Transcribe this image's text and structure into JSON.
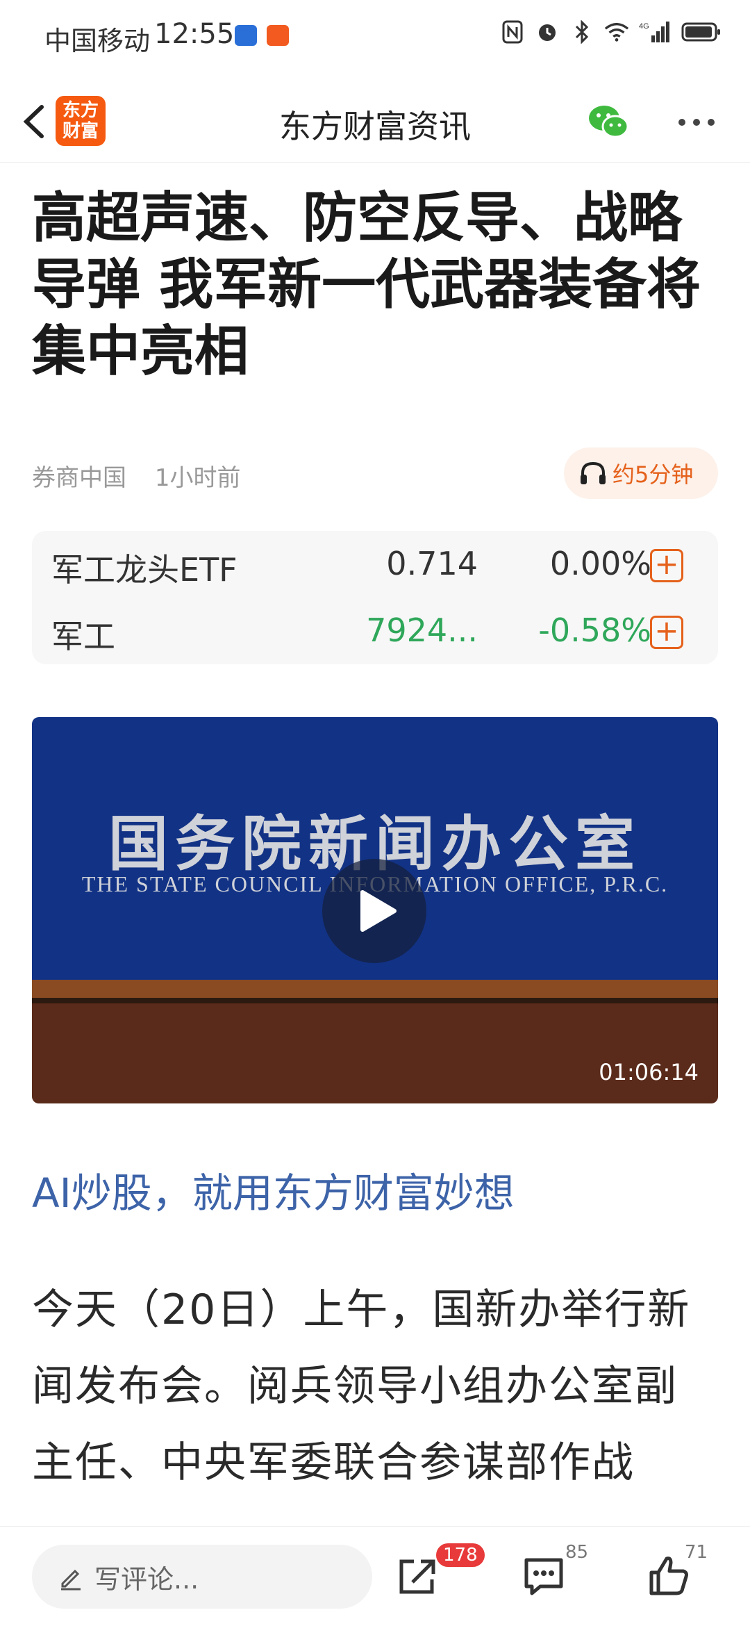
{
  "status_bar": {
    "carrier": "中国移动",
    "time": "12:55",
    "network": "4G"
  },
  "header": {
    "logo_text": "东方财富",
    "title": "东方财富资讯"
  },
  "article": {
    "headline": "高超声速、防空反导、战略导弹 我军新一代武器装备将集中亮相",
    "source": "券商中国",
    "time_ago": "1小时前",
    "listen_label": "约5分钟"
  },
  "stocks": [
    {
      "name": "军工龙头ETF",
      "price": "0.714",
      "change": "0.00%",
      "color": "#333333"
    },
    {
      "name": "军工",
      "price": "7924...",
      "change": "-0.58%",
      "color": "#2fa75a"
    }
  ],
  "video": {
    "title_cn": "国务院新闻办公室",
    "title_en": "THE STATE COUNCIL INFORMATION OFFICE, P.R.C.",
    "duration": "01:06:14"
  },
  "promo": "AI炒股，就用东方财富妙想",
  "body": "今天（20日）上午，国新办举行新闻发布会。阅兵领导小组办公室副主任、中央军委联合参谋部作战",
  "bottom_bar": {
    "comment_placeholder": "写评论...",
    "share_count": "178",
    "comment_count": "85",
    "like_count": "71"
  },
  "colors": {
    "accent": "#f55a10",
    "link": "#3d63a8",
    "down_green": "#2fa75a",
    "badge": "#e83a3a"
  }
}
